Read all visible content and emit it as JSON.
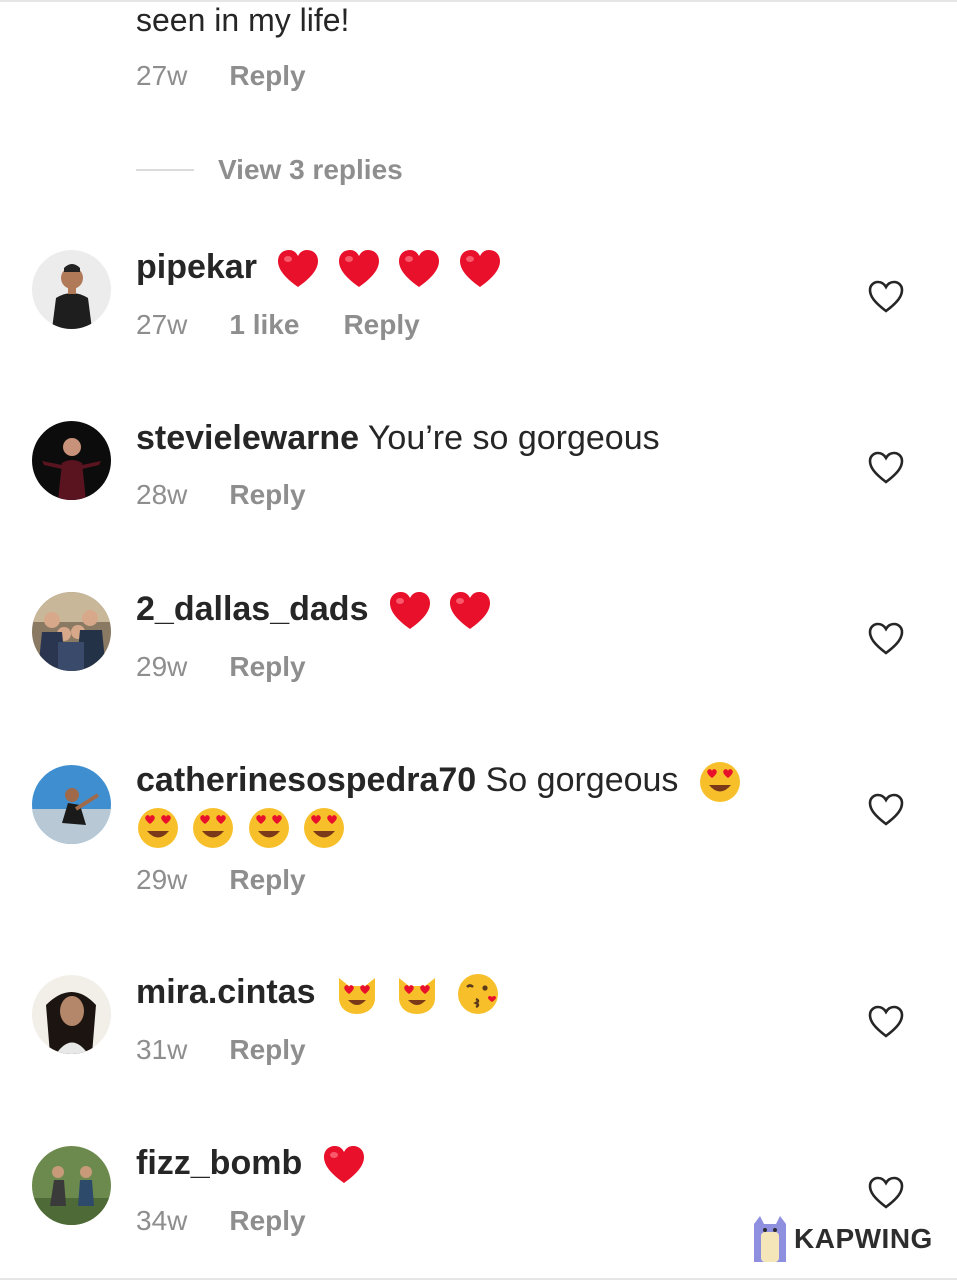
{
  "top_comment": {
    "text": "seen in my life!",
    "time": "27w",
    "reply": "Reply"
  },
  "view_replies": "View 3 replies",
  "comments": [
    {
      "username": "pipekar",
      "text": "",
      "emojis": [
        "red-heart-emoji",
        "red-heart-emoji",
        "red-heart-emoji",
        "red-heart-emoji"
      ],
      "time": "27w",
      "likes": "1 like",
      "reply": "Reply"
    },
    {
      "username": "stevielewarne",
      "text": "You’re so gorgeous",
      "emojis": [],
      "time": "28w",
      "likes": "",
      "reply": "Reply"
    },
    {
      "username": "2_dallas_dads",
      "text": "",
      "emojis": [
        "red-heart-emoji",
        "red-heart-emoji"
      ],
      "time": "29w",
      "likes": "",
      "reply": "Reply"
    },
    {
      "username": "catherinesospedra70",
      "text": "So gorgeous",
      "emojis": [
        "heart-eyes-emoji",
        "heart-eyes-emoji",
        "heart-eyes-emoji",
        "heart-eyes-emoji",
        "heart-eyes-emoji"
      ],
      "time": "29w",
      "likes": "",
      "reply": "Reply"
    },
    {
      "username": "mira.cintas",
      "text": "",
      "emojis": [
        "heart-eyes-cat-emoji",
        "heart-eyes-cat-emoji",
        "kissing-face-emoji"
      ],
      "time": "31w",
      "likes": "",
      "reply": "Reply"
    },
    {
      "username": "fizz_bomb",
      "text": "",
      "emojis": [
        "red-heart-emoji"
      ],
      "time": "34w",
      "likes": "",
      "reply": "Reply"
    }
  ],
  "watermark": "KAPWING",
  "colors": {
    "text": "#262626",
    "meta": "#8e8e8e",
    "divider": "#dbdbdb",
    "heart": "#e8102a"
  }
}
